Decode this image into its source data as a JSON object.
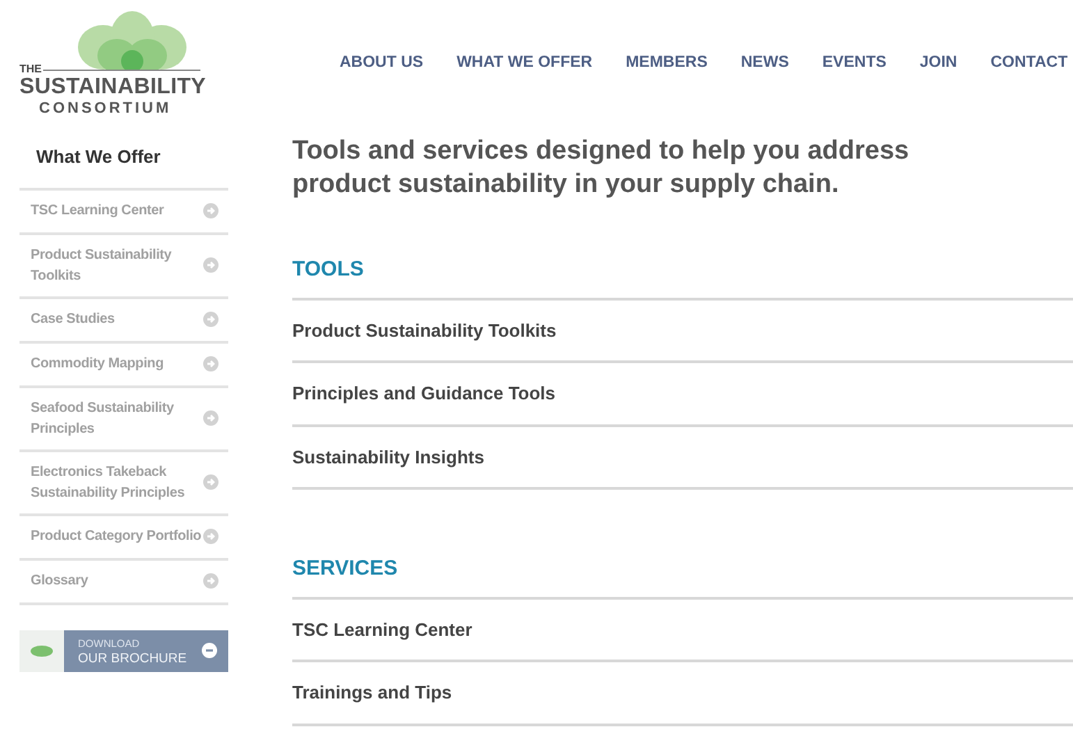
{
  "logo": {
    "top": "THE",
    "main": "SUSTAINABILITY",
    "sub": "CONSORTIUM"
  },
  "nav": [
    "ABOUT US",
    "WHAT WE OFFER",
    "MEMBERS",
    "NEWS",
    "EVENTS",
    "JOIN",
    "CONTACT"
  ],
  "sidebar": {
    "title": "What We Offer",
    "items": [
      "TSC Learning Center",
      "Product Sustainability Toolkits",
      "Case Studies",
      "Commodity Mapping",
      "Seafood Sustainability Principles",
      "Electronics Takeback Sustainability Principles",
      "Product Category Portfolio",
      "Glossary"
    ],
    "brochure": {
      "line1": "DOWNLOAD",
      "line2": "OUR BROCHURE"
    }
  },
  "headline": "Tools and services designed to help you address product sustainability in your supply chain.",
  "sections": [
    {
      "title": "TOOLS",
      "links": [
        "Product Sustainability Toolkits",
        "Principles and Guidance Tools",
        "Sustainability Insights"
      ]
    },
    {
      "title": "SERVICES",
      "links": [
        "TSC Learning Center",
        "Trainings and Tips"
      ]
    }
  ]
}
